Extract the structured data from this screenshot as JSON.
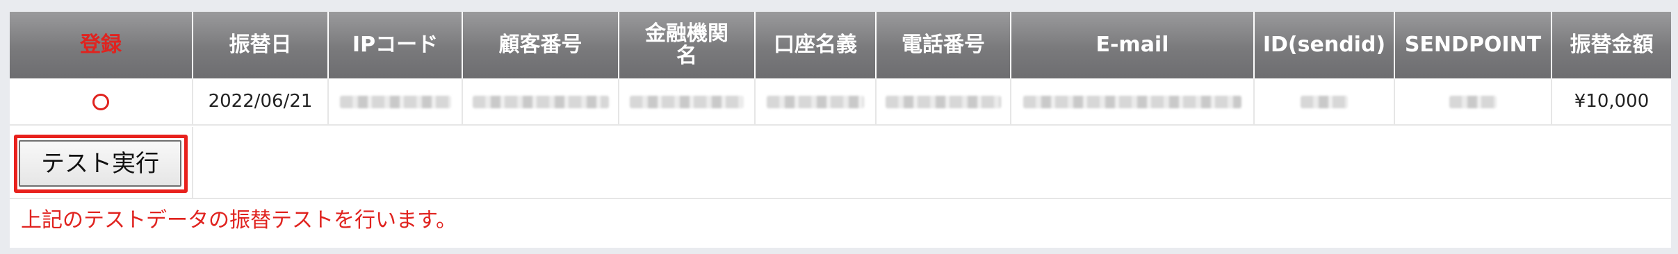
{
  "table": {
    "headers": [
      {
        "label": "登録",
        "color": "#e0231f"
      },
      {
        "label": "振替日"
      },
      {
        "label": "IPコード"
      },
      {
        "label": "顧客番号"
      },
      {
        "label": "金融機関名"
      },
      {
        "label": "口座名義"
      },
      {
        "label": "電話番号"
      },
      {
        "label": "E-mail"
      },
      {
        "label": "ID(sendid)"
      },
      {
        "label": "SENDPOINT"
      },
      {
        "label": "振替金額"
      }
    ],
    "row": {
      "registered_mark": "circle",
      "date": "2022/06/21",
      "ip_code": "",
      "customer_no": "",
      "bank_name": "",
      "account_name": "",
      "phone": "",
      "email": "",
      "sendid": "",
      "sendpoint": "",
      "amount": "¥10,000"
    }
  },
  "test_button": {
    "label": "テスト実行",
    "highlight_color": "#e8211d"
  },
  "note": "上記のテストデータの振替テストを行います。"
}
